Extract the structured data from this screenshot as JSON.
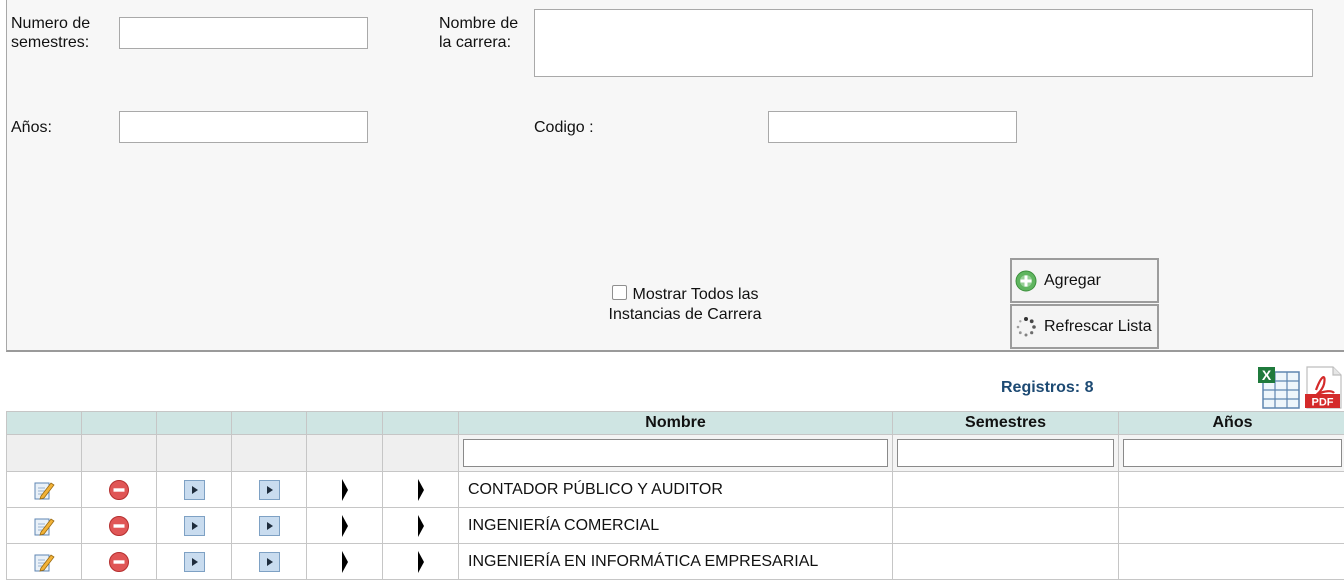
{
  "form": {
    "semesters_label": "Numero de\nsemestres:",
    "semesters_value": "",
    "career_name_label": "Nombre de\nla carrera:",
    "career_name_value": "",
    "years_label": "Años:",
    "years_value": "",
    "code_label": "Codigo :",
    "code_value": "",
    "show_all_label": "Mostrar Todos las Instancias de Carrera",
    "show_all_checked": false
  },
  "buttons": {
    "add_label": "Agregar",
    "refresh_label": "Refrescar Lista"
  },
  "records": {
    "text": "Registros: 8",
    "accent": "#1d4a73"
  },
  "export": {
    "excel_icon": "excel-export-icon",
    "pdf_icon": "pdf-export-icon",
    "pdf_text": "PDF"
  },
  "table": {
    "columns": [
      "",
      "",
      "",
      "",
      "",
      "",
      "Nombre",
      "Semestres",
      "Años"
    ],
    "header_color": "#cfe5e3",
    "row_icons": [
      "edit-icon",
      "delete-icon",
      "play-icon",
      "play-icon",
      "arrow-right-icon",
      "arrow-right-icon"
    ],
    "rows": [
      {
        "nombre": "CONTADOR PÚBLICO Y AUDITOR",
        "semestres": "",
        "anos": ""
      },
      {
        "nombre": "INGENIERÍA COMERCIAL",
        "semestres": "",
        "anos": ""
      },
      {
        "nombre": "INGENIERÍA EN INFORMÁTICA EMPRESARIAL",
        "semestres": "",
        "anos": ""
      }
    ]
  }
}
